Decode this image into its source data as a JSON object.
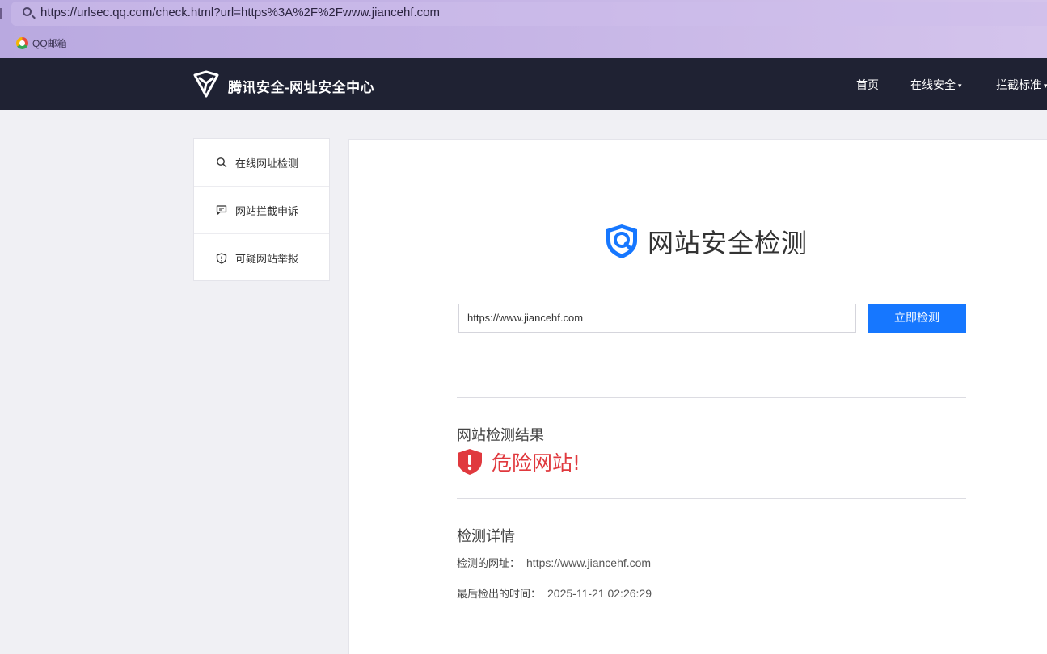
{
  "browser": {
    "address_url": "https://urlsec.qq.com/check.html?url=https%3A%2F%2Fwww.jiancehf.com",
    "bookmarks": [
      {
        "label": "QQ邮箱",
        "icon": "qq-mail-icon"
      }
    ]
  },
  "header": {
    "brand": "腾讯安全-网址安全中心",
    "nav": [
      {
        "label": "首页",
        "has_dropdown": false
      },
      {
        "label": "在线安全",
        "has_dropdown": true
      },
      {
        "label": "拦截标准",
        "has_dropdown": true
      }
    ],
    "dropdown_caret": "▾"
  },
  "sidebar": {
    "items": [
      {
        "label": "在线网址检测",
        "icon": "search-icon"
      },
      {
        "label": "网站拦截申诉",
        "icon": "comment-icon"
      },
      {
        "label": "可疑网站举报",
        "icon": "shield-icon"
      }
    ]
  },
  "main": {
    "title": "网站安全检测",
    "url_input_value": "https://www.jiancehf.com",
    "check_button": "立即检测",
    "result_heading": "网站检测结果",
    "result_text": "危险网站!",
    "details_heading": "检测详情",
    "details": [
      {
        "label": "检测的网址：",
        "value": "https://www.jiancehf.com"
      },
      {
        "label": "最后检出的时间：",
        "value": "2025-11-21 02:26:29"
      }
    ]
  },
  "colors": {
    "nav_bg": "#1f2233",
    "accent": "#1677ff",
    "danger": "#e0393e"
  }
}
